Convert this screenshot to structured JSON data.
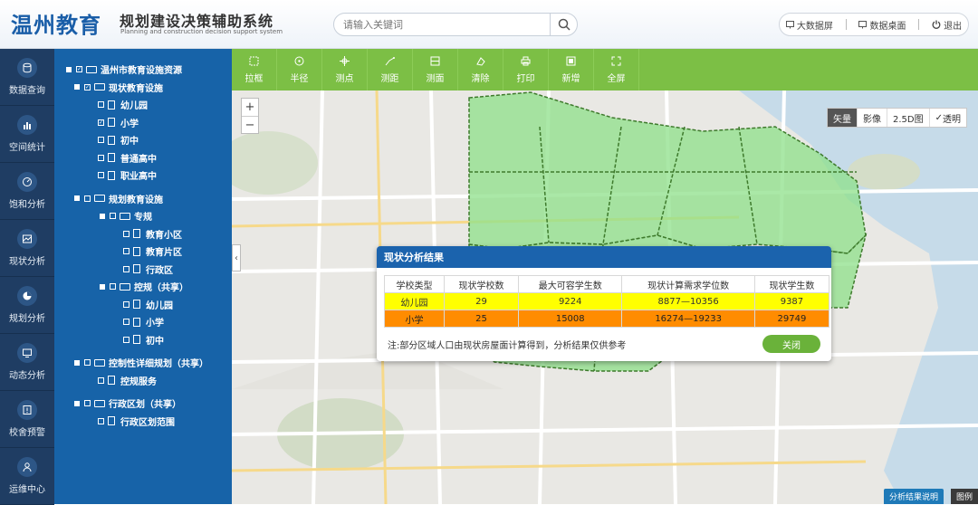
{
  "header": {
    "logo": "温州教育",
    "system_title": "规划建设决策辅助系统",
    "system_subtitle": "Planning and construction decision support system",
    "search_placeholder": "请输入关键词",
    "links": [
      "大数据屏",
      "数据桌面",
      "退出"
    ]
  },
  "sidebar": {
    "items": [
      {
        "label": "数据查询",
        "icon": "database-icon"
      },
      {
        "label": "空间统计",
        "icon": "bar-chart-icon"
      },
      {
        "label": "饱和分析",
        "icon": "gauge-icon"
      },
      {
        "label": "现状分析",
        "icon": "image-chart-icon"
      },
      {
        "label": "规划分析",
        "icon": "pie-chart-icon"
      },
      {
        "label": "动态分析",
        "icon": "monitor-icon"
      },
      {
        "label": "校舍预警",
        "icon": "alert-icon"
      },
      {
        "label": "运维中心",
        "icon": "user-icon"
      }
    ]
  },
  "tree": {
    "root": "温州市教育设施资源",
    "current": "现状教育设施",
    "current_items": [
      "幼儿园",
      "小学",
      "初中",
      "普通高中",
      "职业高中"
    ],
    "planned": "规划教育设施",
    "special": "专规",
    "special_items": [
      "教育小区",
      "教育片区",
      "行政区"
    ],
    "control": "控规（共享）",
    "control_items": [
      "幼儿园",
      "小学",
      "初中"
    ],
    "detail_plan": "控制性详细规划（共享）",
    "detail_items": [
      "控规服务"
    ],
    "admin": "行政区划（共享）",
    "admin_items": [
      "行政区划范围"
    ]
  },
  "toolbar": {
    "tools": [
      {
        "label": "拉框",
        "icon": "rect-select-icon"
      },
      {
        "label": "半径",
        "icon": "radius-icon"
      },
      {
        "label": "测点",
        "icon": "point-icon"
      },
      {
        "label": "测距",
        "icon": "distance-icon"
      },
      {
        "label": "测面",
        "icon": "area-icon"
      },
      {
        "label": "清除",
        "icon": "clear-icon"
      },
      {
        "label": "打印",
        "icon": "print-icon"
      },
      {
        "label": "新增",
        "icon": "add-icon"
      },
      {
        "label": "全屏",
        "icon": "fullscreen-icon"
      }
    ]
  },
  "map": {
    "zoom_in": "+",
    "zoom_out": "−",
    "map_types": [
      "矢量",
      "影像",
      "2.5D图",
      "透明"
    ],
    "active_type": "矢量",
    "zone_color": "#7cd67a"
  },
  "dialog": {
    "title": "现状分析结果",
    "columns": [
      "学校类型",
      "现状学校数",
      "最大可容学生数",
      "现状计算需求学位数",
      "现状学生数"
    ],
    "rows": [
      [
        "幼儿园",
        "29",
        "9224",
        "8877—10356",
        "9387"
      ],
      [
        "小学",
        "25",
        "15008",
        "16274—19233",
        "29749"
      ]
    ],
    "note": "注:部分区域人口由现状房屋面计算得到，分析结果仅供参考",
    "close_label": "关闭"
  },
  "footer": {
    "explain_label": "分析结果说明",
    "legend_label": "图例"
  }
}
